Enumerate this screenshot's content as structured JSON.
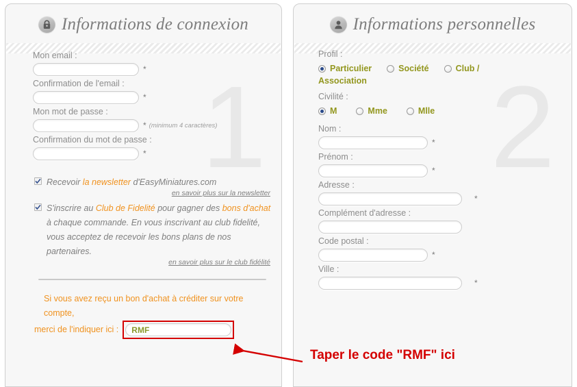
{
  "theme": {
    "panel_bg": "#f7f7f7",
    "panel_border": "#cfcfcf",
    "label_grey": "#8d8d8d",
    "accent_orange": "#f0921f",
    "accent_olive": "#93971f",
    "annotation_red": "#d40000",
    "watermark_grey": "#e8e8e8"
  },
  "left_panel": {
    "icon": "lock-icon",
    "title": "Informations de connexion",
    "watermark": "1",
    "fields": [
      {
        "label": "Mon email :",
        "value": "",
        "placeholder": "",
        "required": "*",
        "hint": ""
      },
      {
        "label": "Confirmation de l'email :",
        "value": "",
        "placeholder": "",
        "required": "*",
        "hint": ""
      },
      {
        "label": "Mon mot de passe :",
        "value": "",
        "placeholder": "",
        "required": "*",
        "hint": "(minimum 4 caractères)"
      },
      {
        "label": "Confirmation du mot de passe :",
        "value": "",
        "placeholder": "",
        "required": "*",
        "hint": ""
      }
    ],
    "newsletter": {
      "checked": true,
      "text_before": "Recevoir ",
      "text_highlight": "la newsletter",
      "text_after": " d'EasyMiniatures.com",
      "more_link": "en savoir plus sur la newsletter"
    },
    "loyalty": {
      "checked": true,
      "part1": "S'inscrire au ",
      "highlight1": "Club de Fidelité",
      "part2": " pour gagner des ",
      "highlight2": "bons d'achat",
      "part3": " à chaque commande. En vous inscrivant au club fidelité, vous acceptez de recevoir les bons plans de nos partenaires.",
      "more_link": "en savoir plus sur le club fidélité"
    },
    "voucher": {
      "line1": "Si vous avez reçu un bon d'achat à créditer sur votre compte,",
      "line2": "merci de l'indiquer ici :",
      "input_value": "RMF",
      "input_placeholder": ""
    }
  },
  "right_panel": {
    "icon": "person-icon",
    "title": "Informations personnelles",
    "watermark": "2",
    "profil": {
      "label": "Profil :",
      "options": [
        {
          "label": "Particulier",
          "selected": true
        },
        {
          "label": "Société",
          "selected": false
        },
        {
          "label": "Club /",
          "selected": false
        }
      ],
      "wrapped_label": "Association"
    },
    "civilite": {
      "label": "Civilité :",
      "options": [
        {
          "label": "M",
          "selected": true
        },
        {
          "label": "Mme",
          "selected": false
        },
        {
          "label": "Mlle",
          "selected": false
        }
      ]
    },
    "fields": [
      {
        "label": "Nom :",
        "value": "",
        "placeholder": "",
        "required": "*",
        "wide": false
      },
      {
        "label": "Prénom :",
        "value": "",
        "placeholder": "",
        "required": "*",
        "wide": false
      },
      {
        "label": "Adresse :",
        "value": "",
        "placeholder": "",
        "required": "*",
        "wide": true
      },
      {
        "label": "Complément d'adresse :",
        "value": "",
        "placeholder": "",
        "required": "",
        "wide": true
      },
      {
        "label": "Code postal :",
        "value": "",
        "placeholder": "",
        "required": "*",
        "wide": false
      },
      {
        "label": "Ville :",
        "value": "",
        "placeholder": "",
        "required": "*",
        "wide": true
      }
    ]
  },
  "annotation": {
    "text": "Taper le code \"RMF\" ici",
    "arrow": "arrow-pointing-left"
  }
}
